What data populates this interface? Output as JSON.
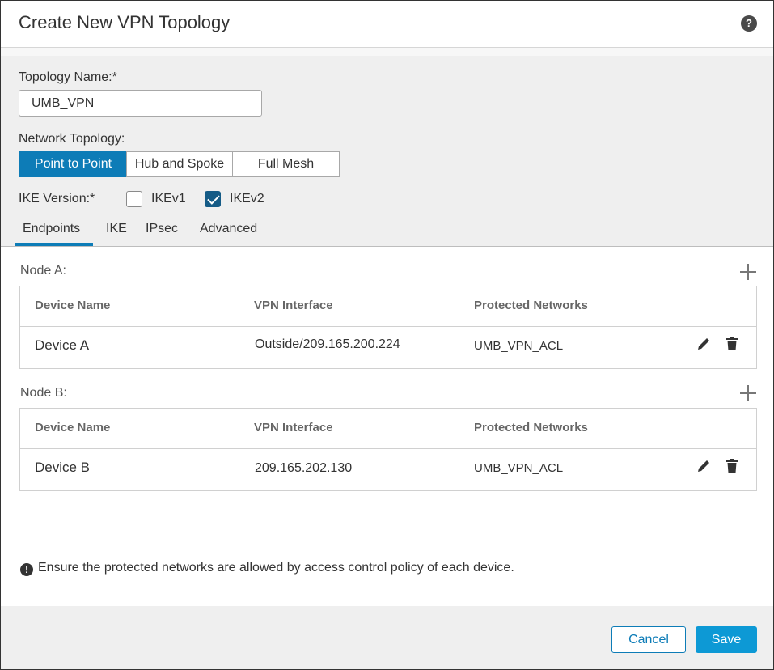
{
  "dialog": {
    "title": "Create New VPN Topology",
    "help_icon": "?"
  },
  "form": {
    "topology_name_label": "Topology Name:*",
    "topology_name_value": "UMB_VPN",
    "network_topology_label": "Network Topology:",
    "topology_options": [
      "Point to Point",
      "Hub and Spoke",
      "Full Mesh"
    ],
    "topology_selected": "Point to Point",
    "ike_version_label": "IKE Version:*",
    "ikev1_label": "IKEv1",
    "ikev1_checked": false,
    "ikev2_label": "IKEv2",
    "ikev2_checked": true
  },
  "tabs": [
    "Endpoints",
    "IKE",
    "IPsec",
    "Advanced"
  ],
  "active_tab": "Endpoints",
  "table_headers": [
    "Device Name",
    "VPN Interface",
    "Protected Networks"
  ],
  "node_a": {
    "label": "Node A:",
    "row": {
      "device": "Device A",
      "interface": "Outside/209.165.200.224",
      "networks": "UMB_VPN_ACL"
    }
  },
  "node_b": {
    "label": "Node B:",
    "row": {
      "device": "Device B",
      "interface": "209.165.202.130",
      "networks": "UMB_VPN_ACL"
    }
  },
  "note": {
    "icon": "!",
    "text": "Ensure the protected networks are allowed by access control policy of each device."
  },
  "footer": {
    "cancel_label": "Cancel",
    "save_label": "Save"
  },
  "colors": {
    "accent": "#0d7cb7",
    "save_button": "#0d99d5",
    "checkbox_checked": "#155b86"
  }
}
